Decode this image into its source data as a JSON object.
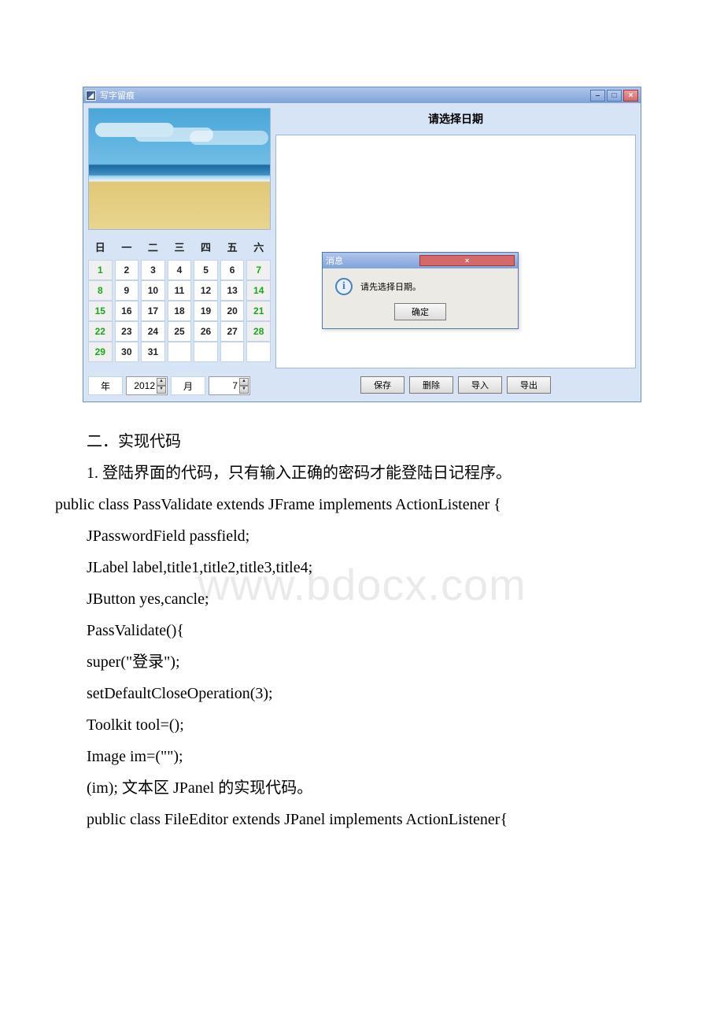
{
  "watermark": "www.bdocx.com",
  "app": {
    "title": "写字留痕",
    "app_icon_glyph": "◢",
    "min_glyph": "–",
    "max_glyph": "□",
    "close_glyph": "×",
    "beach_alt": "beach-image",
    "weekday_headers": [
      "日",
      "一",
      "二",
      "三",
      "四",
      "五",
      "六"
    ],
    "calendar_rows": [
      [
        {
          "v": "1",
          "h": true
        },
        {
          "v": "2"
        },
        {
          "v": "3"
        },
        {
          "v": "4"
        },
        {
          "v": "5"
        },
        {
          "v": "6"
        },
        {
          "v": "7",
          "h": true
        }
      ],
      [
        {
          "v": "8",
          "h": true
        },
        {
          "v": "9"
        },
        {
          "v": "10"
        },
        {
          "v": "11"
        },
        {
          "v": "12"
        },
        {
          "v": "13"
        },
        {
          "v": "14",
          "h": true
        }
      ],
      [
        {
          "v": "15",
          "h": true
        },
        {
          "v": "16"
        },
        {
          "v": "17"
        },
        {
          "v": "18"
        },
        {
          "v": "19"
        },
        {
          "v": "20"
        },
        {
          "v": "21",
          "h": true
        }
      ],
      [
        {
          "v": "22",
          "h": true
        },
        {
          "v": "23"
        },
        {
          "v": "24"
        },
        {
          "v": "25"
        },
        {
          "v": "26"
        },
        {
          "v": "27"
        },
        {
          "v": "28",
          "h": true
        }
      ],
      [
        {
          "v": "29",
          "h": true
        },
        {
          "v": "30"
        },
        {
          "v": "31"
        },
        {
          "v": ""
        },
        {
          "v": ""
        },
        {
          "v": ""
        },
        {
          "v": ""
        }
      ]
    ],
    "year_label": "年",
    "year_value": "2012",
    "month_label": "月",
    "month_value": "7",
    "right_header": "请选择日期",
    "dialog": {
      "title": "消息",
      "close_glyph": "×",
      "info_glyph": "i",
      "message": "请先选择日期。",
      "ok": "确定"
    },
    "actions": {
      "save": "保存",
      "delete": "删除",
      "import": "导入",
      "export": "导出"
    }
  },
  "article": {
    "p1": "二．实现代码",
    "p2": "1.  登陆界面的代码，只有输入正确的密码才能登陆日记程序。",
    "p3": "public class PassValidate extends JFrame implements ActionListener {",
    "p4": " JPasswordField passfield;",
    "p5": " JLabel label,title1,title2,title3,title4;",
    "p6": " JButton yes,cancle;",
    "p7": " PassValidate(){",
    "p8": "  super(\"登录\");",
    "p9": "  setDefaultCloseOperation(3);",
    "p10": "  Toolkit tool=();",
    "p11": "  Image im=(\"\");",
    "p12": "  (im);  文本区 JPanel 的实现代码。",
    "p13": "public class FileEditor extends JPanel implements ActionListener{"
  }
}
